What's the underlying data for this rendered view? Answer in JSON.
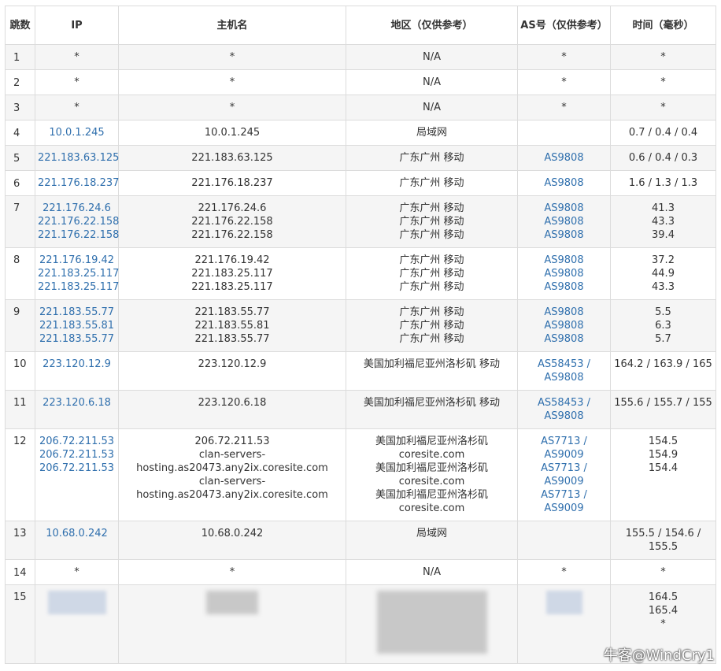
{
  "headers": {
    "hop": "跳数",
    "ip": "IP",
    "host": "主机名",
    "region": "地区（仅供参考）",
    "as": "AS号（仅供参考）",
    "time": "时间（毫秒）"
  },
  "rows": [
    {
      "hop": "1",
      "ips": [
        "*"
      ],
      "hosts": [
        "*"
      ],
      "regions": [
        "N/A"
      ],
      "as": [
        "*"
      ],
      "time": [
        "*"
      ]
    },
    {
      "hop": "2",
      "ips": [
        "*"
      ],
      "hosts": [
        "*"
      ],
      "regions": [
        "N/A"
      ],
      "as": [
        "*"
      ],
      "time": [
        "*"
      ]
    },
    {
      "hop": "3",
      "ips": [
        "*"
      ],
      "hosts": [
        "*"
      ],
      "regions": [
        "N/A"
      ],
      "as": [
        "*"
      ],
      "time": [
        "*"
      ]
    },
    {
      "hop": "4",
      "ips": [
        "10.0.1.245"
      ],
      "hosts": [
        "10.0.1.245"
      ],
      "regions": [
        "局域网"
      ],
      "as": [
        ""
      ],
      "time": [
        "0.7 / 0.4 / 0.4"
      ]
    },
    {
      "hop": "5",
      "ips": [
        "221.183.63.125"
      ],
      "hosts": [
        "221.183.63.125"
      ],
      "regions": [
        "广东广州 移动"
      ],
      "as": [
        "AS9808"
      ],
      "time": [
        "0.6 / 0.4 / 0.3"
      ]
    },
    {
      "hop": "6",
      "ips": [
        "221.176.18.237"
      ],
      "hosts": [
        "221.176.18.237"
      ],
      "regions": [
        "广东广州 移动"
      ],
      "as": [
        "AS9808"
      ],
      "time": [
        "1.6 / 1.3 / 1.3"
      ]
    },
    {
      "hop": "7",
      "ips": [
        "221.176.24.6",
        "221.176.22.158",
        "221.176.22.158"
      ],
      "hosts": [
        "221.176.24.6",
        "221.176.22.158",
        "221.176.22.158"
      ],
      "regions": [
        "广东广州 移动",
        "广东广州 移动",
        "广东广州 移动"
      ],
      "as": [
        "AS9808",
        "AS9808",
        "AS9808"
      ],
      "time": [
        "41.3",
        "43.3",
        "39.4"
      ]
    },
    {
      "hop": "8",
      "ips": [
        "221.176.19.42",
        "221.183.25.117",
        "221.183.25.117"
      ],
      "hosts": [
        "221.176.19.42",
        "221.183.25.117",
        "221.183.25.117"
      ],
      "regions": [
        "广东广州 移动",
        "广东广州 移动",
        "广东广州 移动"
      ],
      "as": [
        "AS9808",
        "AS9808",
        "AS9808"
      ],
      "time": [
        "37.2",
        "44.9",
        "43.3"
      ]
    },
    {
      "hop": "9",
      "ips": [
        "221.183.55.77",
        "221.183.55.81",
        "221.183.55.77"
      ],
      "hosts": [
        "221.183.55.77",
        "221.183.55.81",
        "221.183.55.77"
      ],
      "regions": [
        "广东广州 移动",
        "广东广州 移动",
        "广东广州 移动"
      ],
      "as": [
        "AS9808",
        "AS9808",
        "AS9808"
      ],
      "time": [
        "5.5",
        "6.3",
        "5.7"
      ]
    },
    {
      "hop": "10",
      "ips": [
        "223.120.12.9"
      ],
      "hosts": [
        "223.120.12.9"
      ],
      "regions": [
        "美国加利福尼亚州洛杉矶 移动"
      ],
      "as": [
        "AS58453 /",
        "AS9808"
      ],
      "time": [
        "164.2 / 163.9 / 165"
      ]
    },
    {
      "hop": "11",
      "ips": [
        "223.120.6.18"
      ],
      "hosts": [
        "223.120.6.18"
      ],
      "regions": [
        "美国加利福尼亚州洛杉矶 移动"
      ],
      "as": [
        "AS58453 /",
        "AS9808"
      ],
      "time": [
        "155.6 / 155.7 / 155"
      ]
    },
    {
      "hop": "12",
      "ips": [
        "206.72.211.53",
        "206.72.211.53",
        "206.72.211.53"
      ],
      "hosts": [
        "206.72.211.53",
        "clan-servers-",
        "hosting.as20473.any2ix.coresite.com",
        "clan-servers-",
        "hosting.as20473.any2ix.coresite.com"
      ],
      "regions": [
        "美国加利福尼亚州洛杉矶",
        "coresite.com",
        "美国加利福尼亚州洛杉矶",
        "coresite.com",
        "美国加利福尼亚州洛杉矶",
        "coresite.com"
      ],
      "as": [
        "AS7713 /",
        "AS9009",
        "AS7713 /",
        "AS9009",
        "AS7713 /",
        "AS9009"
      ],
      "time": [
        "154.5",
        "154.9",
        "154.4"
      ]
    },
    {
      "hop": "13",
      "ips": [
        "10.68.0.242"
      ],
      "hosts": [
        "10.68.0.242"
      ],
      "regions": [
        "局域网"
      ],
      "as": [
        ""
      ],
      "time": [
        "155.5 / 154.6 /",
        "155.5"
      ]
    },
    {
      "hop": "14",
      "ips": [
        "*"
      ],
      "hosts": [
        "*"
      ],
      "regions": [
        "N/A"
      ],
      "as": [
        "*"
      ],
      "time": [
        "*"
      ]
    },
    {
      "hop": "15",
      "ips": [],
      "hosts": [],
      "regions": [],
      "as": [],
      "time": [
        "164.5",
        "165.4",
        "*"
      ]
    }
  ],
  "watermark": "牛客@WindCry1",
  "colors": {
    "link": "#2f6fad",
    "border": "#dcdcdc",
    "stripe": "#f5f5f5"
  }
}
